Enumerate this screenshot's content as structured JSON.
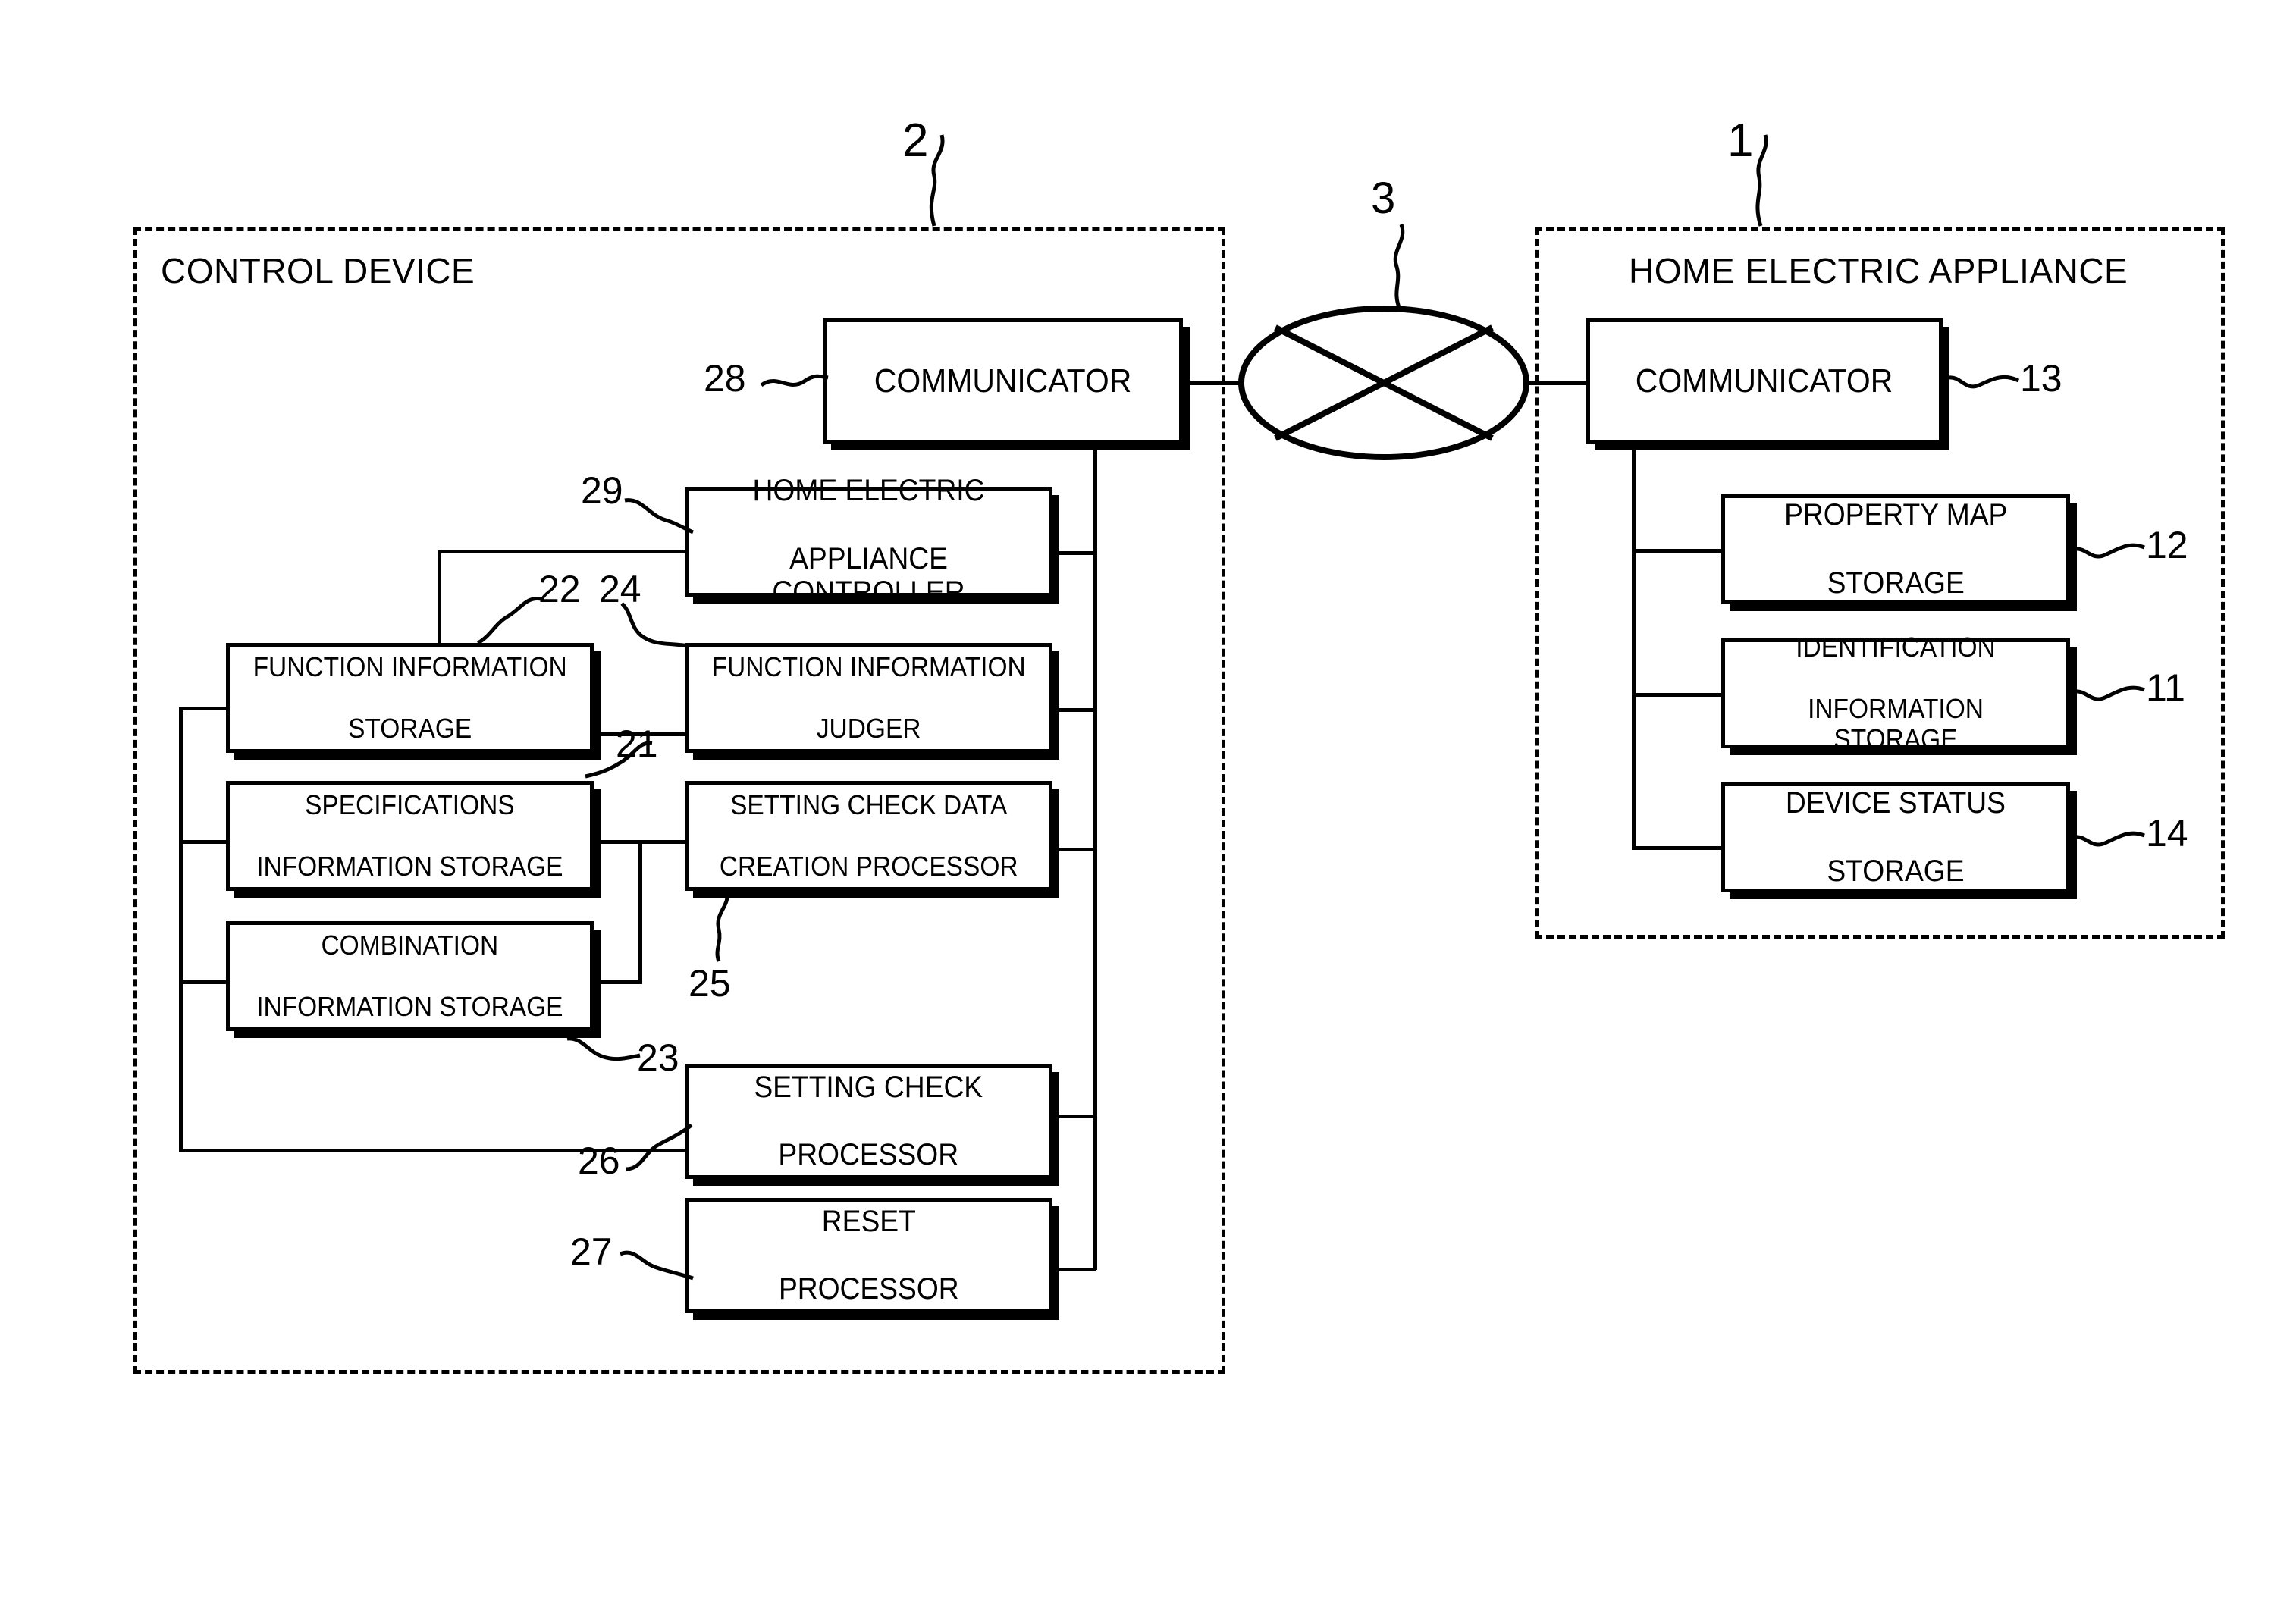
{
  "figure": {
    "type": "block-diagram",
    "domain": "patent-figure"
  },
  "enclosures": [
    {
      "id": "control_device",
      "label": "CONTROL DEVICE",
      "ref": "2"
    },
    {
      "id": "home_electric_appliance",
      "label": "HOME ELECTRIC APPLIANCE",
      "ref": "1"
    }
  ],
  "network": {
    "label": "",
    "ref": "3",
    "icon": "network-cloud-icon"
  },
  "control_device": {
    "communicator": {
      "label": "COMMUNICATOR",
      "ref": "28"
    },
    "appliance_controller": {
      "label_line1": "HOME ELECTRIC",
      "label_line2": "APPLIANCE CONTROLLER",
      "ref": "29"
    },
    "function_information_storage": {
      "label_line1": "FUNCTION INFORMATION",
      "label_line2": "STORAGE",
      "ref": "22"
    },
    "function_information_judger": {
      "label_line1": "FUNCTION INFORMATION",
      "label_line2": "JUDGER",
      "ref": "24"
    },
    "specifications_information_storage": {
      "label_line1": "SPECIFICATIONS",
      "label_line2": "INFORMATION STORAGE",
      "ref": "21"
    },
    "setting_check_data_creation_processor": {
      "label_line1": "SETTING CHECK DATA",
      "label_line2": "CREATION PROCESSOR",
      "ref": "25"
    },
    "combination_information_storage": {
      "label_line1": "COMBINATION",
      "label_line2": "INFORMATION STORAGE",
      "ref": "23"
    },
    "setting_check_processor": {
      "label_line1": "SETTING CHECK",
      "label_line2": "PROCESSOR",
      "ref": "26"
    },
    "reset_processor": {
      "label_line1": "RESET",
      "label_line2": "PROCESSOR",
      "ref": "27"
    }
  },
  "home_electric_appliance": {
    "communicator": {
      "label": "COMMUNICATOR",
      "ref": "13"
    },
    "property_map_storage": {
      "label_line1": "PROPERTY MAP",
      "label_line2": "STORAGE",
      "ref": "12"
    },
    "identification_information_storage": {
      "label_line1": "IDENTIFICATION",
      "label_line2": "INFORMATION STORAGE",
      "ref": "11"
    },
    "device_status_storage": {
      "label_line1": "DEVICE STATUS",
      "label_line2": "STORAGE",
      "ref": "14"
    }
  },
  "colors": {
    "ink": "#000000",
    "paper": "#ffffff"
  }
}
